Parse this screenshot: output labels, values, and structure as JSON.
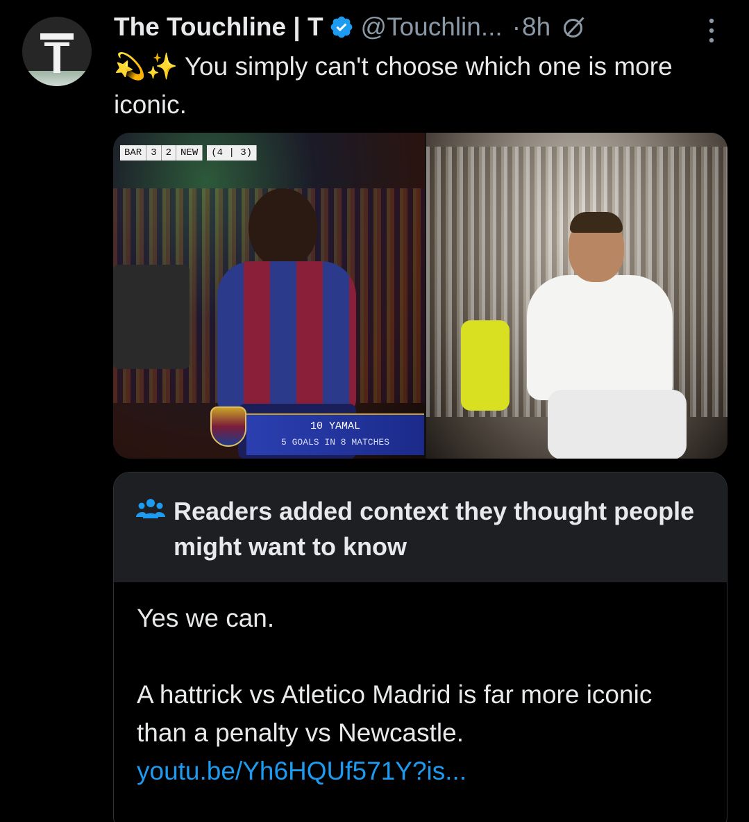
{
  "author": {
    "name": "The Touchline | T",
    "handle": "@Touchlin...",
    "separator": "·",
    "time": "8h",
    "avatar_letter": "T"
  },
  "icons": {
    "verified": "verified-badge-icon",
    "grok": "grok-icon",
    "more": "more-options-icon",
    "readers": "readers-people-icon"
  },
  "tweet": {
    "emoji": "💫✨",
    "text": "You simply can't choose which one is more iconic."
  },
  "media": {
    "left": {
      "scorebug_home": "BAR",
      "scorebug_home_score": "3",
      "scorebug_away_score": "2",
      "scorebug_away": "NEW",
      "scorebug_agg": "(4 | 3)",
      "lower_third_name": "10 YAMAL",
      "lower_third_stat": "5 GOALS IN 8 MATCHES"
    }
  },
  "community_note": {
    "title": "Readers added context they thought people might want to know",
    "line1": "Yes we can.",
    "line2": "A hattrick vs Atletico Madrid is far more iconic than a penalty vs Newcastle.",
    "link": "youtu.be/Yh6HQUf571Y?is..."
  },
  "colors": {
    "background": "#000000",
    "text": "#e7e9ea",
    "secondary": "#8b98a5",
    "link": "#1d9bf0",
    "verified": "#1d9bf0",
    "note_header": "#1d1f23"
  }
}
